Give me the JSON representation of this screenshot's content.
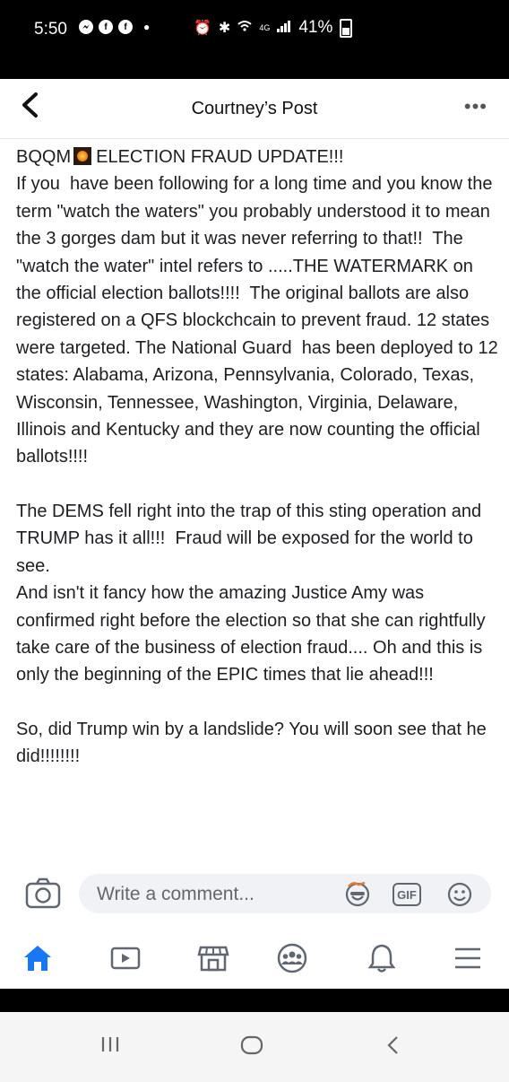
{
  "status_bar": {
    "time": "5:50",
    "notifications": [
      "messenger-icon",
      "facebook-icon",
      "facebook-icon"
    ],
    "network": "4G",
    "battery": "41%"
  },
  "header": {
    "title": "Courtney’s Post"
  },
  "post": {
    "line1_prefix": "BQQM",
    "line1_suffix": "ELECTION FRAUD UPDATE!!!",
    "paragraph1": "If you  have been following for a long time and you know the term \"watch the waters\" you probably understood it to mean the 3 gorges dam but it was never referring to that!!  The \"watch the water\" intel refers to .....THE WATERMARK on the official election ballots!!!!  The original ballots are also registered on a QFS blockchcain to prevent fraud. 12 states were targeted. The National Guard  has been deployed to 12 states: Alabama, Arizona, Pennsylvania, Colorado, Texas, Wisconsin, Tennessee, Washington, Virginia, Delaware, Illinois and Kentucky and they are now counting the official ballots!!!!",
    "paragraph2": "The DEMS fell right into the trap of this sting operation and TRUMP has it all!!!  Fraud will be exposed for the world to see.\nAnd isn't it fancy how the amazing Justice Amy was confirmed right before the election so that she can rightfully take care of the business of election fraud.... Oh and this is only the beginning of the EPIC times that lie ahead!!!",
    "paragraph3": "So, did Trump win by a landslide? You will soon see that he did!!!!!!!!"
  },
  "composer": {
    "placeholder": "Write a comment...",
    "gif_label": "GIF"
  },
  "tabs": [
    "home-icon",
    "watch-icon",
    "marketplace-icon",
    "groups-icon",
    "notifications-icon",
    "menu-icon"
  ],
  "colors": {
    "accent": "#1877f2",
    "icon_gray": "#606770"
  }
}
